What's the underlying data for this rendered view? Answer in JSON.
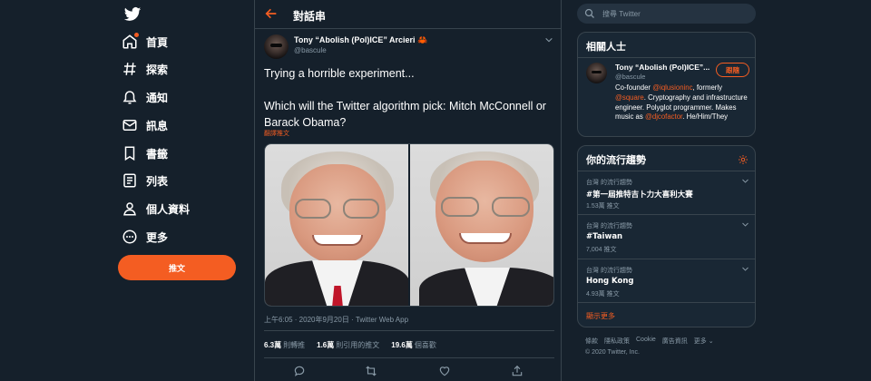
{
  "nav": {
    "items": [
      {
        "label": "首頁",
        "icon": "home-icon"
      },
      {
        "label": "探索",
        "icon": "hashtag-icon"
      },
      {
        "label": "通知",
        "icon": "bell-icon"
      },
      {
        "label": "訊息",
        "icon": "mail-icon"
      },
      {
        "label": "書籤",
        "icon": "bookmark-icon"
      },
      {
        "label": "列表",
        "icon": "list-icon"
      },
      {
        "label": "個人資料",
        "icon": "person-icon"
      },
      {
        "label": "更多",
        "icon": "more-icon"
      }
    ],
    "tweet_button": "推文"
  },
  "thread": {
    "header_title": "對話串",
    "author_name": "Tony “Abolish (Pol)ICE” Arcieri",
    "author_emoji": "🦀",
    "author_handle": "@bascule",
    "text": "Trying a horrible experiment...\n\nWhich will the Twitter algorithm pick: Mitch McConnell or Barack Obama?",
    "translate": "翻譯推文",
    "timestamp": "上午6:05 · 2020年9月20日 · Twitter Web App",
    "stats": [
      {
        "value": "6.3萬",
        "label": "則轉推"
      },
      {
        "value": "1.6萬",
        "label": "則引用的推文"
      },
      {
        "value": "19.6萬",
        "label": "個喜歡"
      }
    ]
  },
  "search": {
    "placeholder": "搜尋 Twitter"
  },
  "related": {
    "title": "相關人士",
    "name": "Tony “Abolish (Pol)ICE”...",
    "handle": "@bascule",
    "follow": "跟隨",
    "bio_parts": [
      {
        "text": "Co-founder ",
        "mention": false
      },
      {
        "text": "@iqlusioninc",
        "mention": true
      },
      {
        "text": ", formerly ",
        "mention": false
      },
      {
        "text": "@square",
        "mention": true
      },
      {
        "text": ". Cryptography and infrastructure engineer. Polyglot programmer. Makes music as ",
        "mention": false
      },
      {
        "text": "@djcofactor",
        "mention": true
      },
      {
        "text": ". He/Him/They",
        "mention": false
      }
    ]
  },
  "trends": {
    "title": "你的流行趨勢",
    "items": [
      {
        "context": "台灣 的流行趨勢",
        "name": "#第一屆推特吉卜力大喜利大賽",
        "count": "1.53萬 推文"
      },
      {
        "context": "台灣 的流行趨勢",
        "name": "#Taiwan",
        "count": "7,004 推文"
      },
      {
        "context": "台灣 的流行趨勢",
        "name": "Hong Kong",
        "count": "4.93萬 推文"
      }
    ],
    "show_more": "顯示更多"
  },
  "footer": {
    "links": [
      "條款",
      "隱私政策",
      "Cookie",
      "廣告資訊",
      "更多 ⌄"
    ],
    "copyright": "© 2020 Twitter, Inc."
  },
  "colors": {
    "accent": "#f45d22",
    "background": "#15202b",
    "card": "#192734",
    "border": "#38444d",
    "muted": "#8899a6"
  }
}
